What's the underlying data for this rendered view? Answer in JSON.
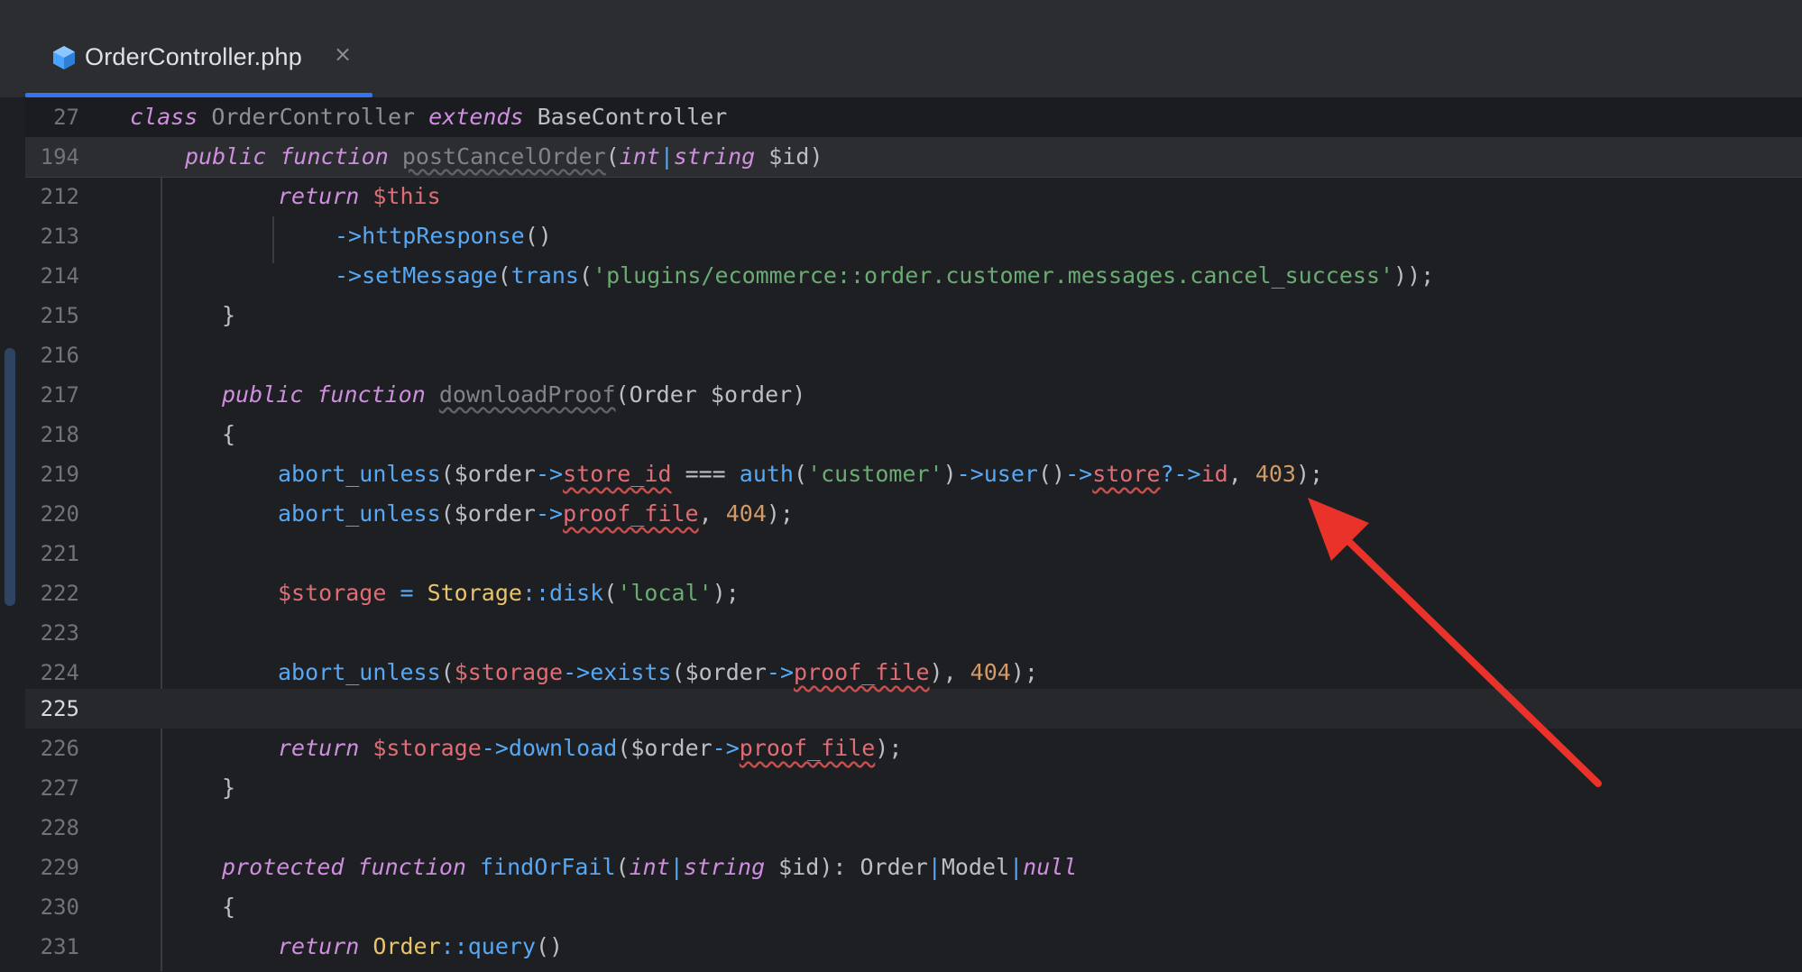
{
  "tab": {
    "icon": "php-file-icon",
    "label": "OrderController.php",
    "close": "×"
  },
  "colors": {
    "accent": "#3574f0",
    "keyword": "#cf8ee0",
    "function": "#56a8f5",
    "string": "#6aab73",
    "number": "#d19a66",
    "variable": "#e06c75",
    "annotation_arrow": "#e8322a"
  },
  "sticky": {
    "line1": {
      "number": "27",
      "kw1": "class",
      "name": "OrderController",
      "kw2": "extends",
      "base": "BaseController"
    },
    "line2": {
      "number": "194",
      "kw1": "public",
      "kw2": "function",
      "name": "postCancelOrder",
      "open": "(",
      "t1": "int",
      "bar": "|",
      "t2": "string",
      "rest": " $id)"
    }
  },
  "lines": {
    "212": {
      "number": "212",
      "kw": "return",
      "var": "$this"
    },
    "213": {
      "number": "213",
      "arrow": "->",
      "fn": "httpResponse",
      "rest": "()"
    },
    "214": {
      "number": "214",
      "arrow": "->",
      "fn": "setMessage",
      "p1": "(",
      "fn2": "trans",
      "p2": "(",
      "str": "'plugins/ecommerce::order.customer.messages.cancel_success'",
      "end": "));"
    },
    "215": {
      "number": "215",
      "text": "}"
    },
    "216": {
      "number": "216"
    },
    "217": {
      "number": "217",
      "kw1": "public",
      "kw2": "function",
      "name": "downloadProof",
      "rest": "(Order $order)"
    },
    "218": {
      "number": "218",
      "text": "{"
    },
    "219": {
      "number": "219",
      "fn": "abort_unless",
      "a": "($order",
      "arrow1": "->",
      "prop1": "store_id",
      "b": " === ",
      "fn2": "auth",
      "c": "(",
      "str": "'customer'",
      "d": ")",
      "arrow2": "->",
      "fn3": "user",
      "e": "()",
      "arrow3": "->",
      "prop2": "store",
      "f": "?->",
      "g": "id",
      "h": ", ",
      "num": "403",
      "i": ");"
    },
    "220": {
      "number": "220",
      "fn": "abort_unless",
      "a": "($order",
      "arrow": "->",
      "prop": "proof_file",
      "b": ", ",
      "num": "404",
      "c": ");"
    },
    "221": {
      "number": "221"
    },
    "222": {
      "number": "222",
      "var": "$storage",
      "eq": " = ",
      "cls": "Storage",
      "sep": "::",
      "fn": "disk",
      "a": "(",
      "str": "'local'",
      "b": ");"
    },
    "223": {
      "number": "223"
    },
    "224": {
      "number": "224",
      "fn": "abort_unless",
      "a": "(",
      "var": "$storage",
      "arrow1": "->",
      "fn2": "exists",
      "b": "($order",
      "arrow2": "->",
      "prop": "proof_file",
      "c": "), ",
      "num": "404",
      "d": ");"
    },
    "225": {
      "number": "225"
    },
    "226": {
      "number": "226",
      "kw": "return",
      "var": " $storage",
      "arrow1": "->",
      "fn": "download",
      "a": "($order",
      "arrow2": "->",
      "prop": "proof_file",
      "b": ");"
    },
    "227": {
      "number": "227",
      "text": "}"
    },
    "228": {
      "number": "228"
    },
    "229": {
      "number": "229",
      "kw1": "protected",
      "kw2": "function",
      "name": "findOrFail",
      "a": "(",
      "t1": "int",
      "bar1": "|",
      "t2": "string",
      "b": " $id): Order",
      "bar2": "|",
      "c": "Model",
      "bar3": "|",
      "t3": "null"
    },
    "230": {
      "number": "230",
      "text": "{"
    },
    "231": {
      "number": "231",
      "kw": "return",
      "cls": " Order",
      "sep": "::",
      "fn": "query",
      "a": "()"
    }
  }
}
